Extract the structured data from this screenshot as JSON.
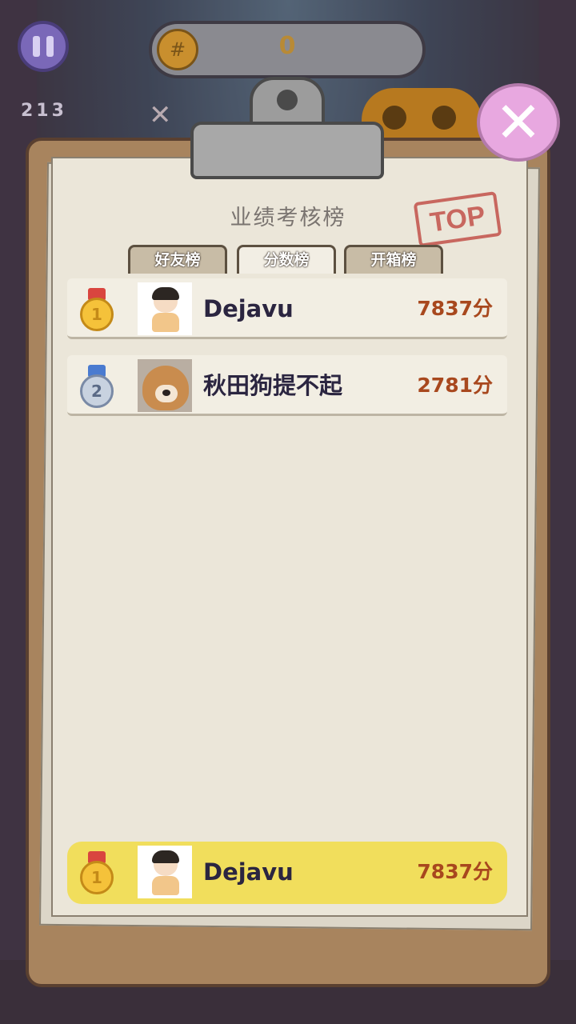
{
  "hud": {
    "coin_value": "0",
    "blocks_label": "213"
  },
  "board": {
    "title": "业绩考核榜",
    "stamp": "TOP",
    "tabs": [
      {
        "label": "好友榜",
        "active": false
      },
      {
        "label": "分数榜",
        "active": true
      },
      {
        "label": "开箱榜",
        "active": false
      }
    ],
    "entries": [
      {
        "rank": "1",
        "name": "Dejavu",
        "score": "7837分",
        "avatar": "boy-avatar"
      },
      {
        "rank": "2",
        "name": "秋田狗提不起",
        "score": "2781分",
        "avatar": "dog-avatar"
      }
    ],
    "my_entry": {
      "rank": "1",
      "name": "Dejavu",
      "score": "7837分",
      "avatar": "boy-avatar"
    }
  },
  "colors": {
    "gold_medal": "#f5c23a",
    "silver_medal": "#c8d2e0",
    "score_text": "#a8481e",
    "my_row_highlight": "#f1de5c",
    "close_button": "#e8a8e0"
  }
}
